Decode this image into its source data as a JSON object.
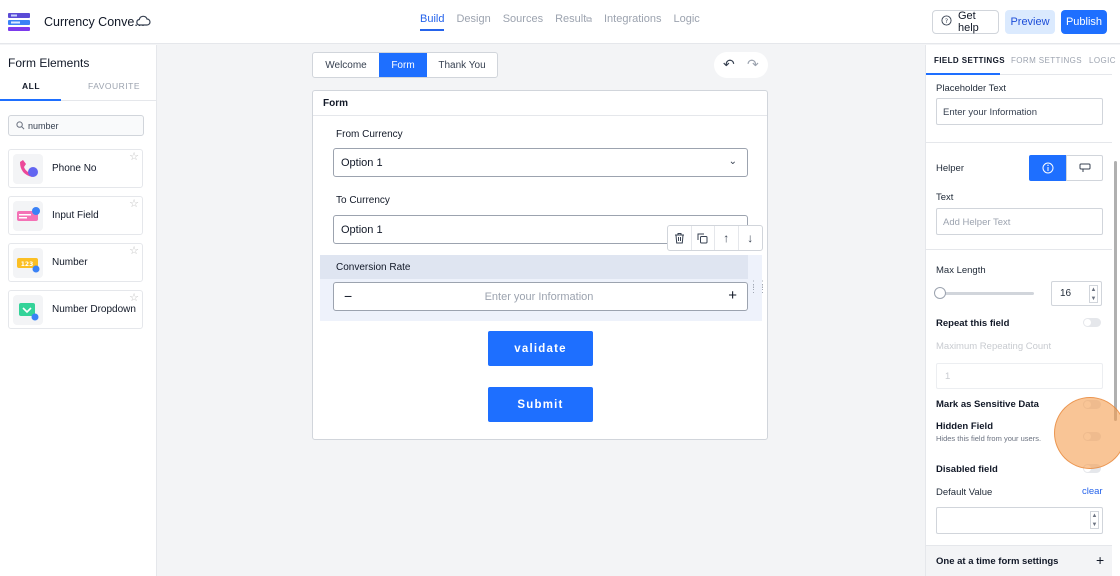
{
  "app": {
    "title": "Currency Conve..."
  },
  "nav": {
    "tabs": [
      {
        "label": "Build",
        "active": true
      },
      {
        "label": "Design"
      },
      {
        "label": "Sources"
      },
      {
        "label": "Result"
      },
      {
        "label": "Integrations"
      },
      {
        "label": "Logic"
      }
    ]
  },
  "header": {
    "help_label": "Get help",
    "preview_label": "Preview",
    "publish_label": "Publish"
  },
  "sidebar": {
    "title": "Form Elements",
    "tabs": {
      "all": "ALL",
      "favourite": "FAVOURITE"
    },
    "search_value": "number",
    "items": [
      {
        "label": "Phone No",
        "icon": "phone-icon"
      },
      {
        "label": "Input Field",
        "icon": "input-field-icon"
      },
      {
        "label": "Number",
        "icon": "number-icon"
      },
      {
        "label": "Number Dropdown",
        "icon": "number-dropdown-icon"
      }
    ]
  },
  "canvas": {
    "page_tabs": {
      "welcome": "Welcome",
      "form": "Form",
      "thank_you": "Thank You"
    },
    "form_title": "Form",
    "fields": {
      "from_currency": {
        "label": "From Currency",
        "value": "Option 1"
      },
      "to_currency": {
        "label": "To Currency",
        "value": "Option 1"
      },
      "conversion_rate": {
        "label": "Conversion Rate",
        "placeholder": "Enter your Information"
      }
    },
    "validate_label": "validate",
    "submit_label": "Submit"
  },
  "settings": {
    "tabs": {
      "field": "FIELD SETTINGS",
      "form": "FORM SETTINGS",
      "logic": "LOGIC"
    },
    "placeholder_text": {
      "label": "Placeholder Text",
      "value": "Enter your Information"
    },
    "helper": {
      "label": "Helper"
    },
    "text": {
      "label": "Text",
      "placeholder": "Add Helper Text"
    },
    "max_length": {
      "label": "Max Length",
      "value": "16"
    },
    "repeat": {
      "label": "Repeat this field",
      "max_label": "Maximum Repeating Count",
      "max_value": "1"
    },
    "sensitive": {
      "label": "Mark as Sensitive Data"
    },
    "hidden": {
      "label": "Hidden Field",
      "help": "Hides this field from your users."
    },
    "disabled": {
      "label": "Disabled field"
    },
    "default_value": {
      "label": "Default Value",
      "clear": "clear"
    },
    "one_at_a_time": {
      "label": "One at a time form settings"
    }
  },
  "colors": {
    "accent": "#1e6fff",
    "highlight": "#f59e50"
  }
}
